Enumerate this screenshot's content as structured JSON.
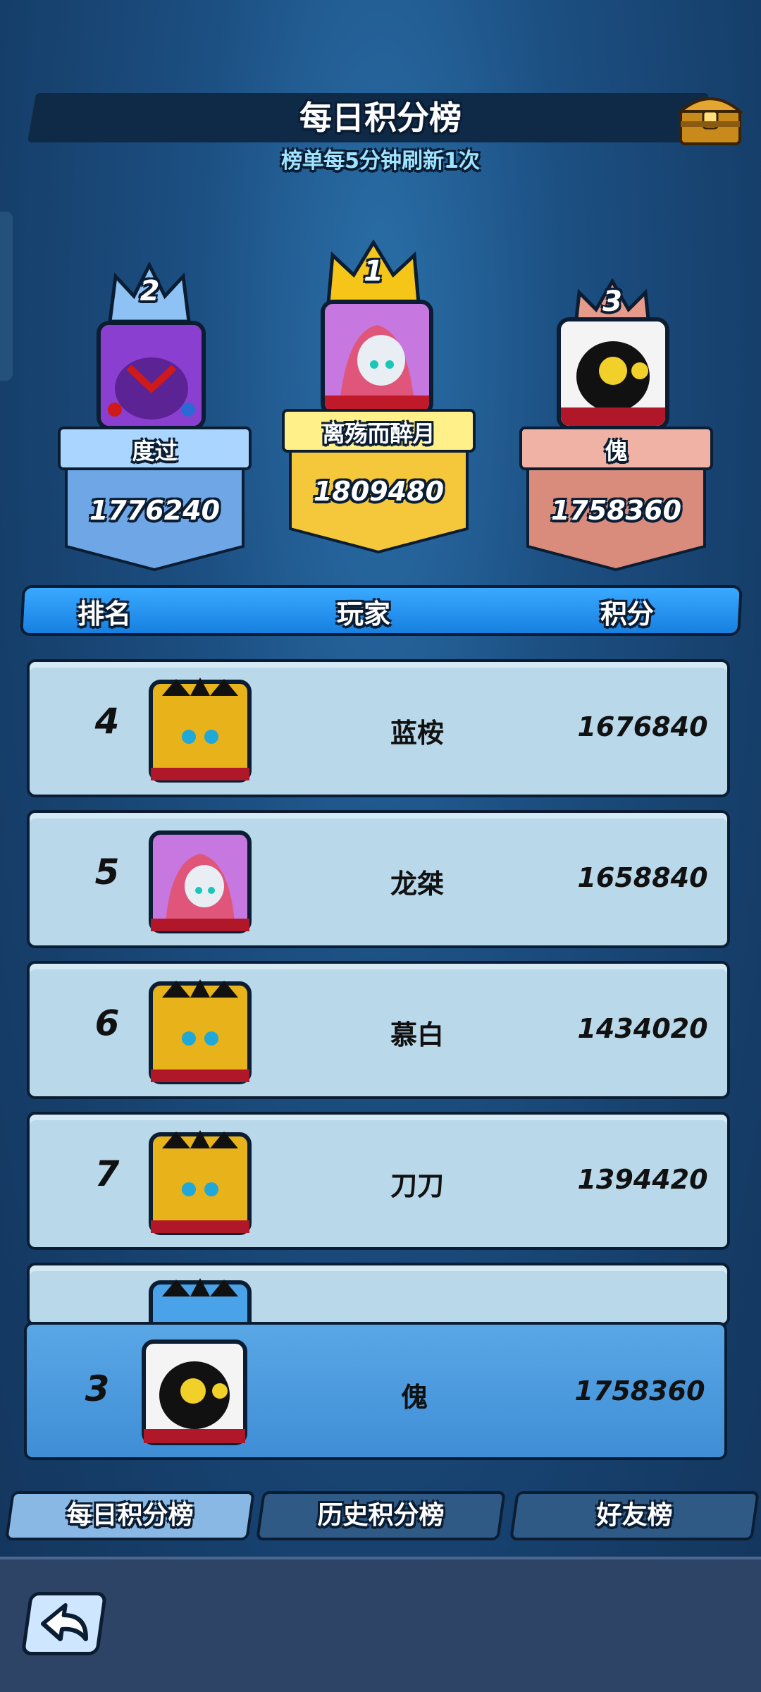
{
  "header": {
    "title": "每日积分榜",
    "subtitle": "榜单每5分钟刷新1次"
  },
  "podium": {
    "first": {
      "rank": "1",
      "name": "离殇而醉月",
      "score": "1809480"
    },
    "second": {
      "rank": "2",
      "name": "度过",
      "score": "1776240"
    },
    "third": {
      "rank": "3",
      "name": "傀",
      "score": "1758360"
    }
  },
  "table": {
    "col_rank": "排名",
    "col_player": "玩家",
    "col_score": "积分",
    "rows": [
      {
        "rank": "4",
        "name": "蓝桉",
        "score": "1676840",
        "avatar": "yellow-spiky-monster"
      },
      {
        "rank": "5",
        "name": "龙桀",
        "score": "1658840",
        "avatar": "pink-hooded-ghost"
      },
      {
        "rank": "6",
        "name": "慕白",
        "score": "1434020",
        "avatar": "yellow-spiky-monster"
      },
      {
        "rank": "7",
        "name": "刀刀",
        "score": "1394420",
        "avatar": "yellow-spiky-monster"
      }
    ]
  },
  "my_rank": {
    "rank": "3",
    "name": "傀",
    "score": "1758360",
    "avatar": "black-white-shadow"
  },
  "tabs": [
    {
      "label": "每日积分榜",
      "active": true
    },
    {
      "label": "历史积分榜",
      "active": false
    },
    {
      "label": "好友榜",
      "active": false
    }
  ],
  "colors": {
    "gold": "#f5c518",
    "silver_blue": "#7fb8f0",
    "bronze": "#d98c7c",
    "row_bg": "#b9d8ea",
    "highlight_row": "#4f9ce0"
  }
}
